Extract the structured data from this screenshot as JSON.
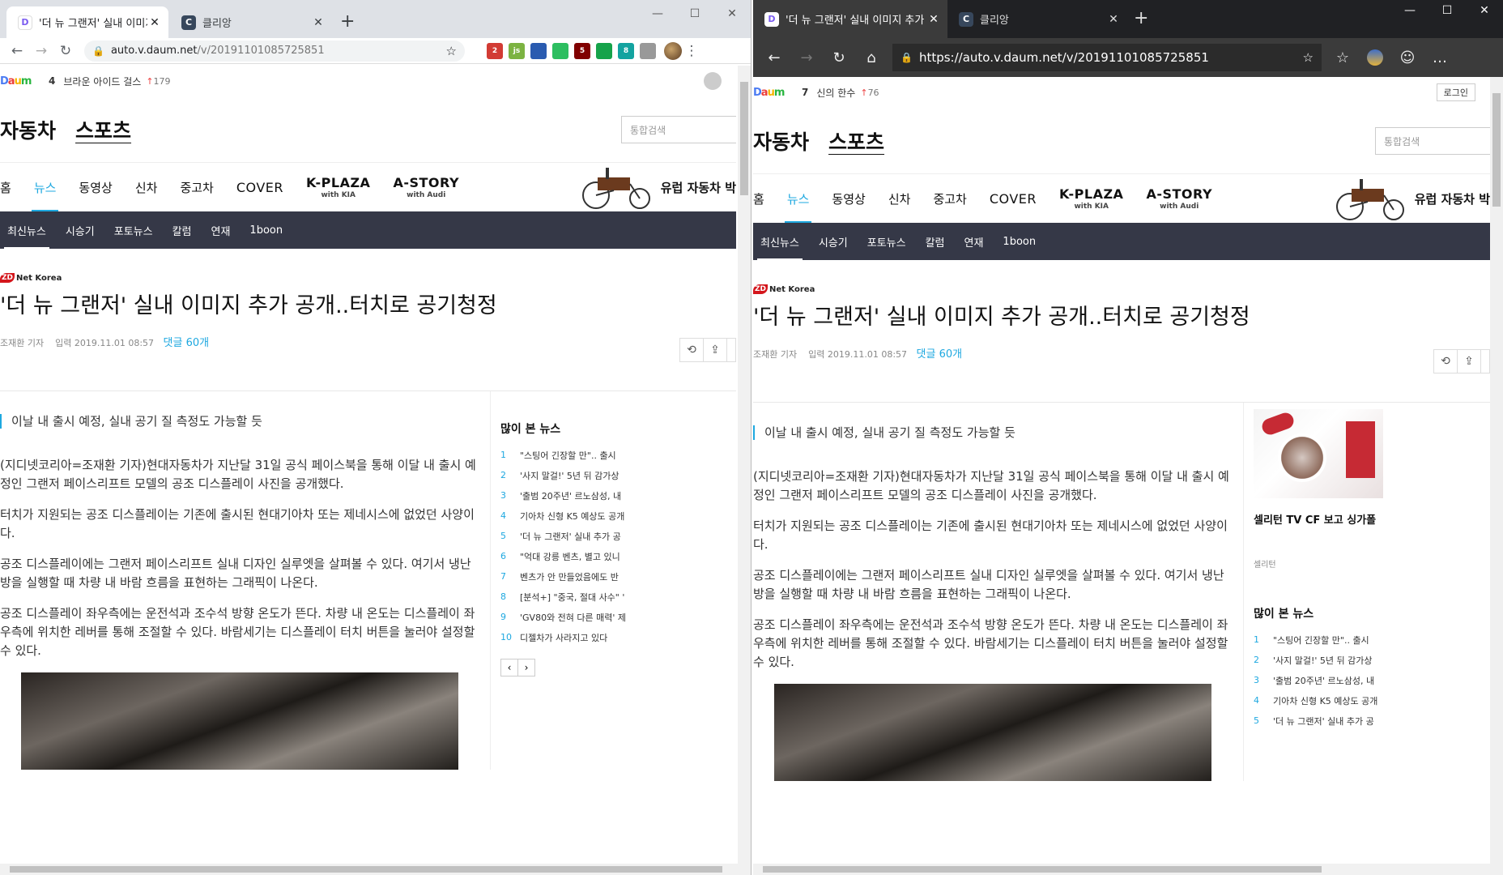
{
  "chrome": {
    "tab_active_title": "'더 뉴 그랜저' 실내 이미지 추가",
    "tab2_title": "클리앙",
    "url_host": "auto.v.daum.net",
    "url_path": "/v/20191101085725851",
    "extensions": [
      {
        "icon": "mail-ext-icon",
        "badge": "2",
        "color": "#d23b34"
      },
      {
        "icon": "js-ext-icon",
        "badge": "js",
        "color": "#7cb342"
      },
      {
        "icon": "chat-ext-icon",
        "badge": "",
        "color": "#2a5bb0"
      },
      {
        "icon": "evernote-ext-icon",
        "badge": "",
        "color": "#2dbe60"
      },
      {
        "icon": "ublock-ext-icon",
        "badge": "5",
        "color": "#800000"
      },
      {
        "icon": "grammarly-ext-icon",
        "badge": "",
        "color": "#16a34a"
      },
      {
        "icon": "rss-ext-icon",
        "badge": "8",
        "color": "#13a3a0"
      },
      {
        "icon": "cursor-ext-icon",
        "badge": "",
        "color": "#999999"
      }
    ]
  },
  "edge": {
    "tab_active_title": "'더 뉴 그랜저' 실내 이미지 추가",
    "tab2_title": "클리앙",
    "url": "https://auto.v.daum.net/v/20191101085725851"
  },
  "daum_left": {
    "rank_num": "4",
    "rank_keyword": "브라운 아이드 걸스",
    "rank_change": "179"
  },
  "daum_right": {
    "rank_num": "7",
    "rank_keyword": "신의 한수",
    "rank_change": "76",
    "login": "로그인"
  },
  "page": {
    "section1": "자동차",
    "section2": "스포츠",
    "search_placeholder": "통합검색",
    "gnb": [
      "홈",
      "뉴스",
      "동영상",
      "신차",
      "중고차",
      "COVER"
    ],
    "kplaza": "K-PLAZA",
    "kplaza_sub": "with KIA",
    "astory": "A-STORY",
    "astory_sub": "with Audi",
    "promo": "유럽 자동차 박",
    "lnb": [
      "최신뉴스",
      "시승기",
      "포토뉴스",
      "칼럼",
      "연재",
      "1boon"
    ],
    "press": "Net Korea",
    "press_badge": "ZD",
    "headline": "'더 뉴 그랜저' 실내 이미지 추가 공개..터치로 공기청정",
    "reporter": "조재환 기자",
    "input_label": "입력 2019.11.01 08:57",
    "comments": "댓글 60개",
    "summary": "이날 내 출시 예정, 실내 공기 질 측정도 가능할 듯",
    "paragraphs": [
      "(지디넷코리아=조재환 기자)현대자동차가 지난달 31일 공식 페이스북을 통해 이달 내 출시 예정인 그랜저 페이스리프트 모델의 공조 디스플레이 사진을 공개했다.",
      "터치가 지원되는 공조 디스플레이는 기존에 출시된 현대기아차 또는 제네시스에 없었던 사양이다.",
      "공조 디스플레이에는 그랜저 페이스리프트 실내 디자인 실루엣을 살펴볼 수 있다. 여기서 냉난방을 실행할 때 차량 내 바람 흐름을 표현하는 그래픽이 나온다.",
      "공조 디스플레이 좌우측에는 운전석과 조수석 방향 온도가 뜬다. 차량 내 온도는 디스플레이 좌우측에 위치한 레버를 통해 조절할 수 있다. 바람세기는 디스플레이 터치 버튼을 눌러야 설정할 수 있다."
    ],
    "popular_title": "많이 본 뉴스",
    "popular": [
      "\"스팅어 긴장할 만\".. 출시",
      "'사지 말걸!' 5년 뒤 감가상",
      "'출범 20주년' 르노삼성, 내",
      "기아차 신형 K5 예상도 공개",
      "'더 뉴 그랜저' 실내 추가 공",
      "\"억대 강릉 벤츠, 별고 있니",
      "벤츠가 안 만들었음에도 반",
      "[분석+] \"중국, 절대 사수\" '",
      "'GV80와 전혀 다른 매력' 제",
      "디젤차가 사라지고 있다"
    ],
    "ad_title": "셀리턴 TV CF 보고 싱가폴",
    "ad_source": "셀리턴"
  }
}
